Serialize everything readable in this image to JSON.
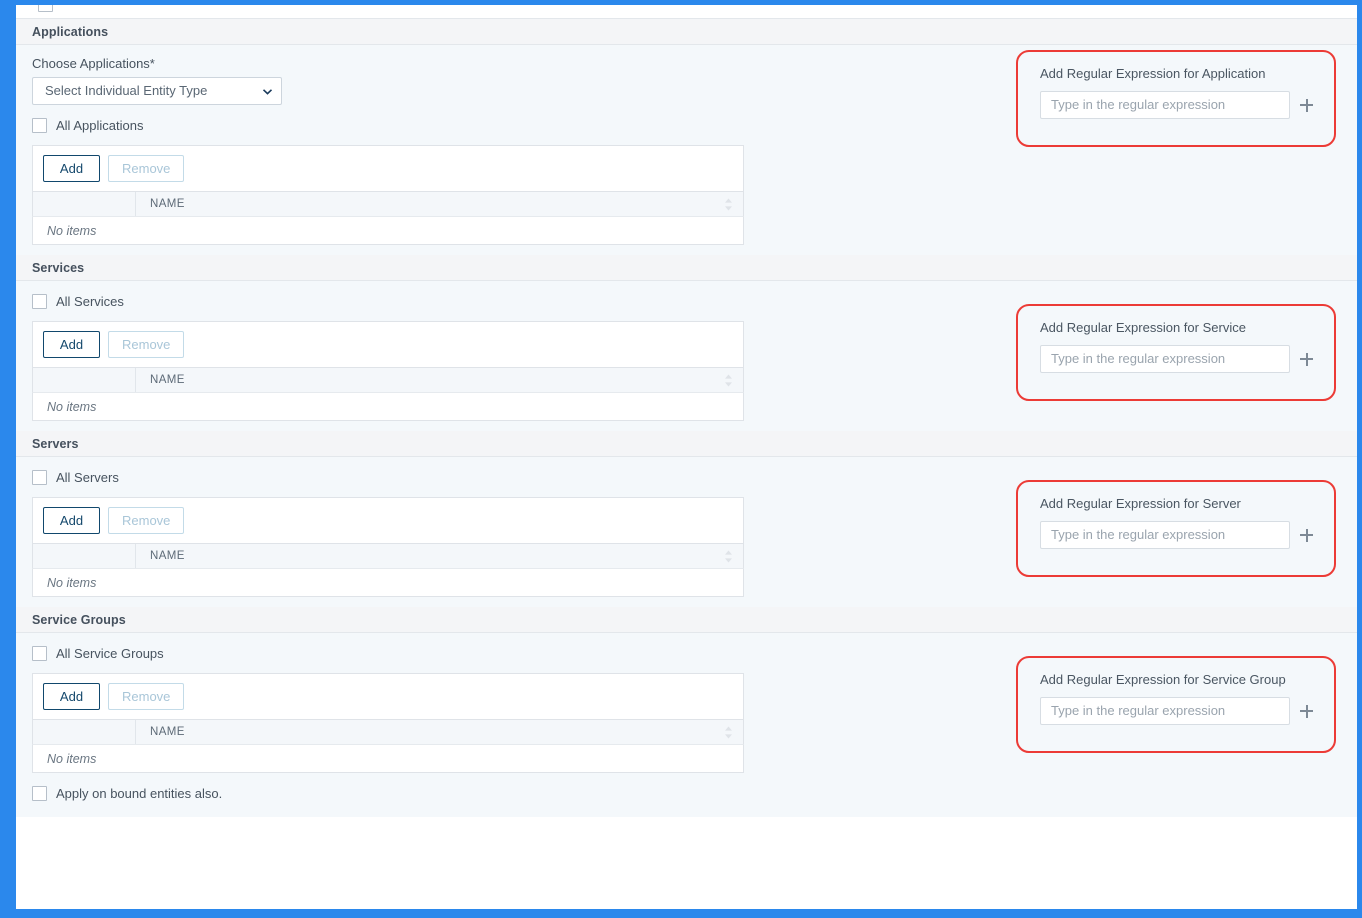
{
  "theme": {
    "frame_color": "#2b88ec",
    "callout_border": "#ec3b36",
    "section_header_bg": "#f4f5f7",
    "body_bg": "#f4f8fb",
    "primary_border": "#11486d"
  },
  "grid_common": {
    "add_label": "Add",
    "remove_label": "Remove",
    "name_column": "NAME",
    "empty_text": "No items"
  },
  "regex_common": {
    "placeholder": "Type in the regular expression",
    "add_icon": "plus-icon",
    "value": ""
  },
  "sections": [
    {
      "id": "applications",
      "title": "Applications",
      "field_label": "Choose Applications*",
      "select_value": "Select Individual Entity Type",
      "select_icon": "chevron-down-icon",
      "checkbox_label": "All Applications",
      "checkbox_checked": false,
      "regex_label": "Add Regular Expression for Application"
    },
    {
      "id": "services",
      "title": "Services",
      "checkbox_label": "All Services",
      "checkbox_checked": false,
      "regex_label": "Add Regular Expression for Service"
    },
    {
      "id": "servers",
      "title": "Servers",
      "checkbox_label": "All Servers",
      "checkbox_checked": false,
      "regex_label": "Add Regular Expression for Server"
    },
    {
      "id": "service-groups",
      "title": "Service Groups",
      "checkbox_label": "All Service Groups",
      "checkbox_checked": false,
      "regex_label": "Add Regular Expression for Service Group"
    }
  ],
  "footer": {
    "apply_bound_label": "Apply on bound entities also.",
    "apply_bound_checked": false
  }
}
